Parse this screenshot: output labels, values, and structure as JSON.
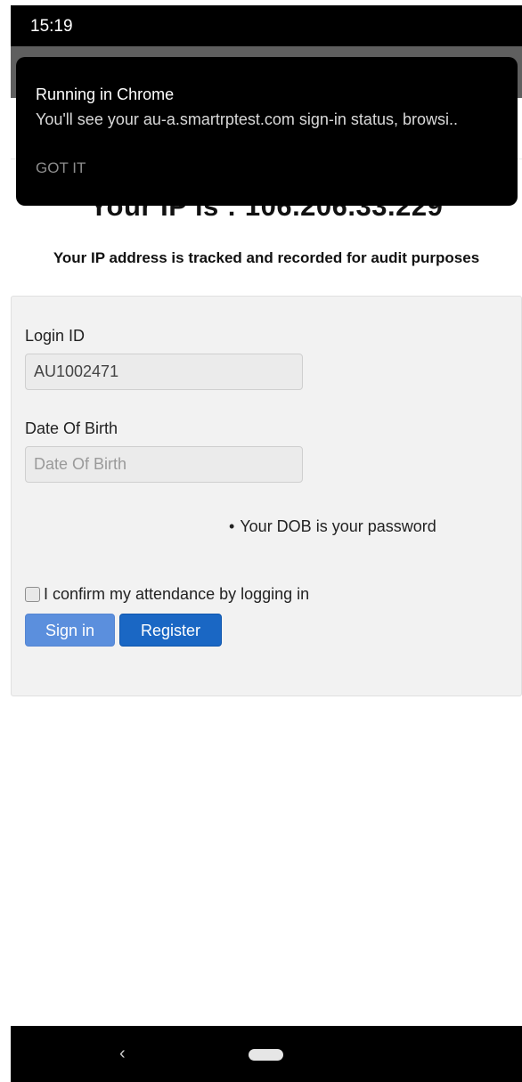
{
  "status_bar": {
    "time": "15:19"
  },
  "toast": {
    "title": "Running in Chrome",
    "body": "You'll see your au-a.smartrptest.com sign-in status, browsi..",
    "action": "GOT IT"
  },
  "page": {
    "ip_heading": "Your IP is : 106.206.33.229",
    "audit_text": "Your IP address is tracked and recorded for audit purposes"
  },
  "login_form": {
    "login_id_label": "Login ID",
    "login_id_value": "AU1002471",
    "dob_label": "Date Of Birth",
    "dob_placeholder": "Date Of Birth",
    "dob_note": "Your DOB is your password",
    "confirm_label": "I confirm my attendance by logging in",
    "confirm_checked": false,
    "signin_label": "Sign in",
    "register_label": "Register",
    "signin_color": "#5b8fdd",
    "register_color": "#1a67c4"
  },
  "nav_bar": {
    "back_icon": "back-chevron-icon",
    "home_icon": "home-pill-icon"
  }
}
